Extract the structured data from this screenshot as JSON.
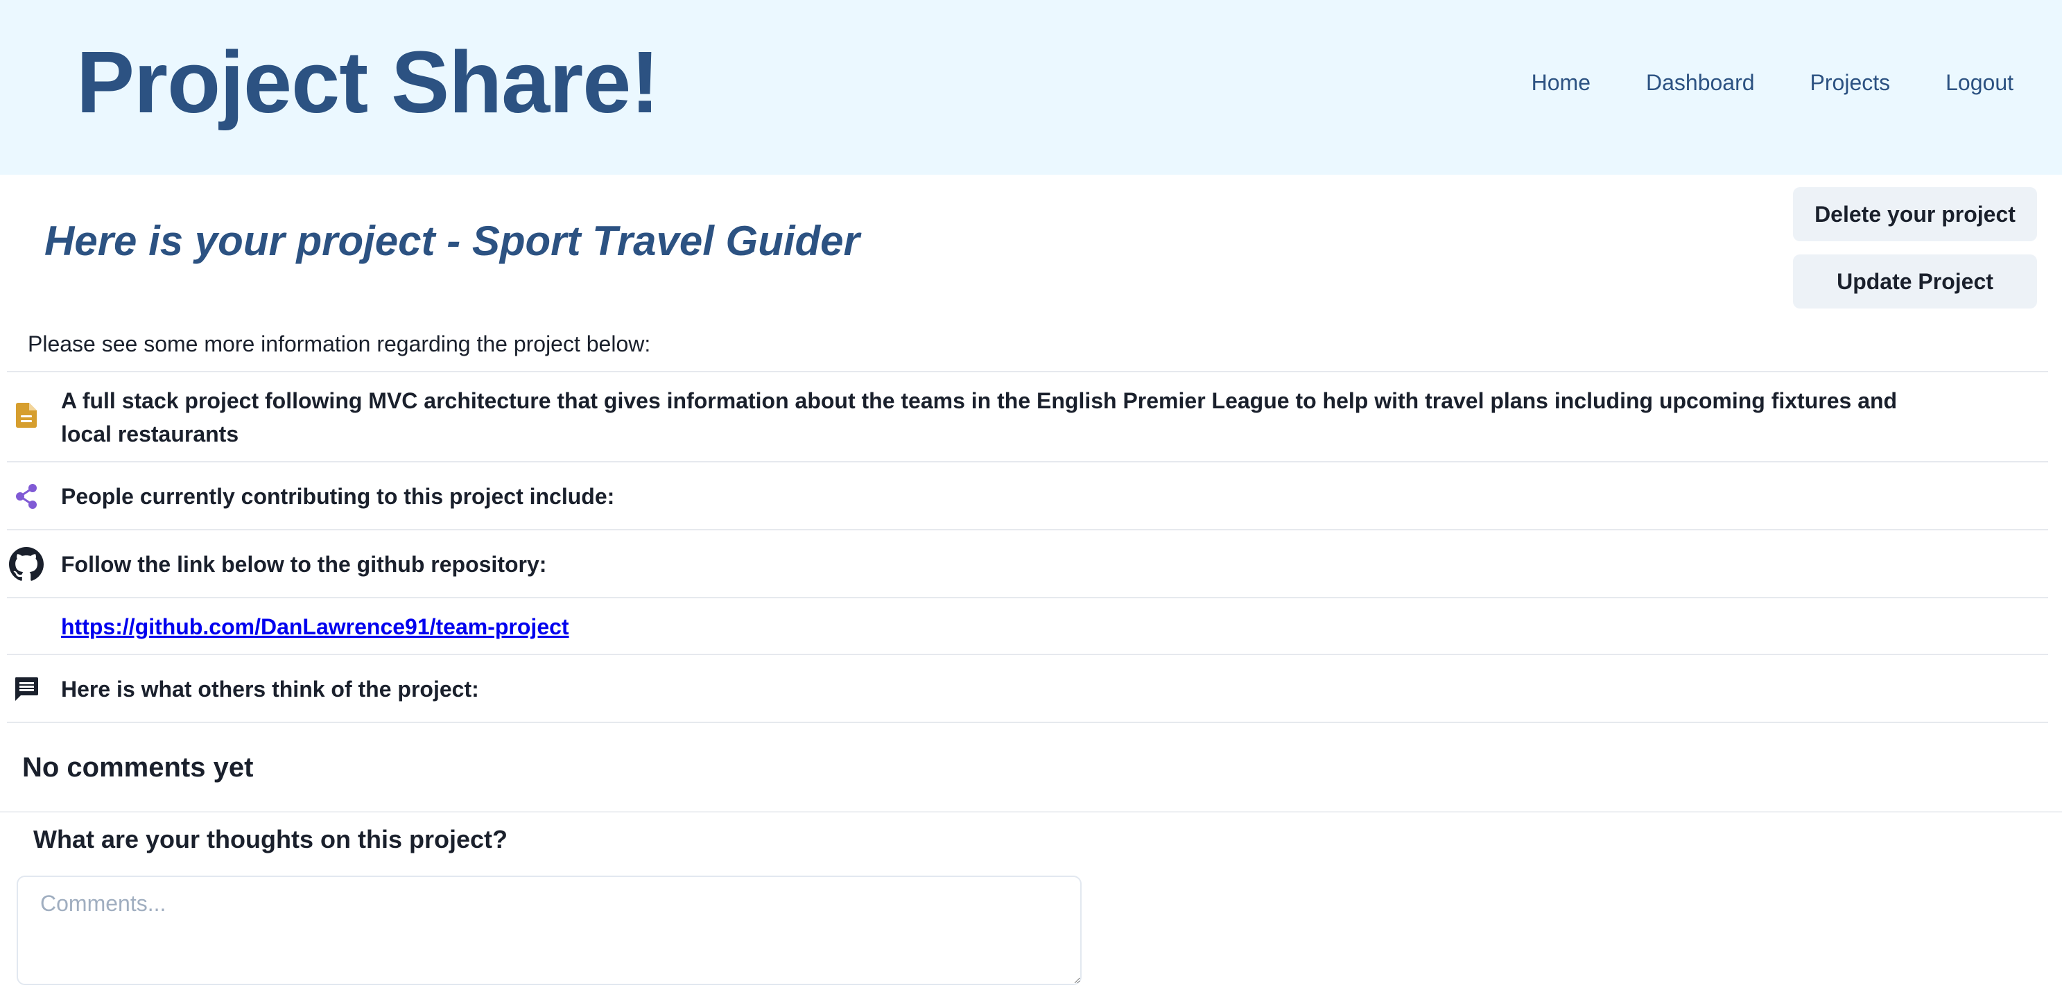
{
  "app": {
    "title": "Project Share!"
  },
  "nav": {
    "items": [
      "Home",
      "Dashboard",
      "Projects",
      "Logout"
    ]
  },
  "project": {
    "heading": "Here is your project - Sport Travel Guider",
    "intro": "Please see some more information regarding the project below:",
    "description": "A full stack project following MVC architecture that gives information about the teams in the English Premier League to help with travel plans including upcoming fixtures and local restaurants",
    "contributors_label": "People currently contributing to this project include:",
    "github_label": "Follow the link below to the github repository:",
    "github_url": "https://github.com/DanLawrence91/team-project",
    "reviews_label": "Here is what others think of the project:"
  },
  "actions": {
    "delete_label": "Delete your project",
    "update_label": "Update Project"
  },
  "comments": {
    "empty_text": "No comments yet",
    "prompt": "What are your thoughts on this project?",
    "placeholder": "Comments..."
  },
  "icons": {
    "description": "document-icon",
    "contributors": "share-icon",
    "github": "github-icon",
    "reviews": "comment-icon"
  },
  "colors": {
    "header_bg": "#ebf8ff",
    "brand": "#2c5282",
    "button_bg": "#edf2f7",
    "document_icon": "#d69e2e",
    "share_icon": "#805ad5",
    "link": "#0000ee"
  }
}
